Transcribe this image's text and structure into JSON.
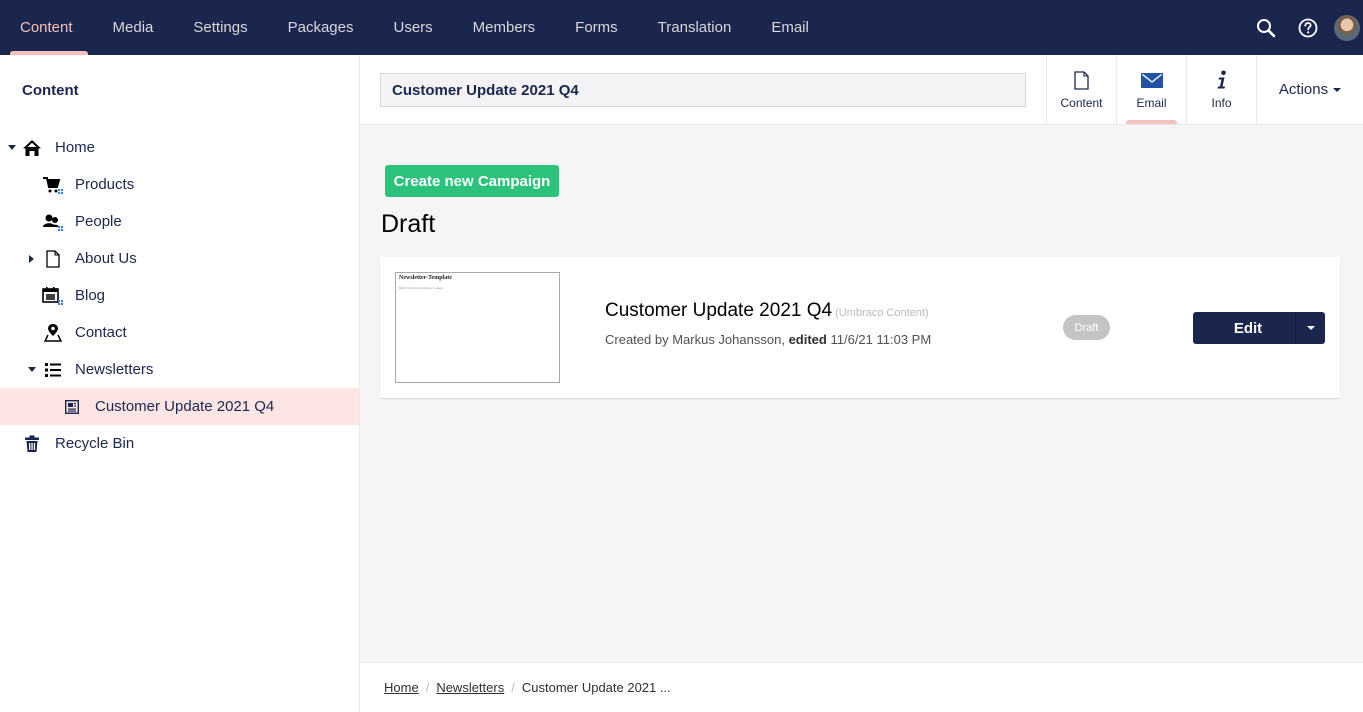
{
  "topnav": {
    "tabs": [
      {
        "label": "Content",
        "active": true
      },
      {
        "label": "Media"
      },
      {
        "label": "Settings"
      },
      {
        "label": "Packages"
      },
      {
        "label": "Users"
      },
      {
        "label": "Members"
      },
      {
        "label": "Forms"
      },
      {
        "label": "Translation"
      },
      {
        "label": "Email"
      }
    ],
    "icons": [
      "search-icon",
      "help-icon",
      "user-avatar"
    ]
  },
  "sidebar": {
    "title": "Content",
    "tree": [
      {
        "label": "Home",
        "icon": "home-icon",
        "expanded": true,
        "level": 0
      },
      {
        "label": "Products",
        "icon": "cart-icon",
        "level": 1
      },
      {
        "label": "People",
        "icon": "people-icon",
        "level": 1
      },
      {
        "label": "About Us",
        "icon": "document-icon",
        "expanded": false,
        "level": 1
      },
      {
        "label": "Blog",
        "icon": "calendar-icon",
        "level": 1
      },
      {
        "label": "Contact",
        "icon": "map-pin-icon",
        "level": 1
      },
      {
        "label": "Newsletters",
        "icon": "list-icon",
        "expanded": true,
        "level": 1
      },
      {
        "label": "Customer Update 2021 Q4",
        "icon": "newspaper-icon",
        "level": 2,
        "selected": true
      },
      {
        "label": "Recycle Bin",
        "icon": "trash-icon",
        "level": 0
      }
    ]
  },
  "editor": {
    "name_value": "Customer Update 2021 Q4",
    "apps": [
      {
        "label": "Content",
        "icon": "document-icon"
      },
      {
        "label": "Email",
        "icon": "envelope-icon",
        "active": true
      },
      {
        "label": "Info",
        "icon": "info-icon"
      }
    ],
    "actions_label": "Actions"
  },
  "main": {
    "create_button": "Create new Campaign",
    "section_title": "Draft",
    "campaign": {
      "thumbnail_title": "Newsletter-Template",
      "thumbnail_text": "Hello World from Umbraco Content",
      "title": "Customer Update 2021 Q4",
      "source": "(Umbraco Content)",
      "created_prefix": "Created by Markus Johansson,",
      "edited_label": "edited",
      "edited_date": "11/6/21 11:03 PM",
      "status": "Draft",
      "edit_label": "Edit"
    }
  },
  "breadcrumb": {
    "items": [
      {
        "label": "Home",
        "link": true
      },
      {
        "label": "Newsletters",
        "link": true
      },
      {
        "label": "Customer Update 2021 ...",
        "link": false
      }
    ]
  },
  "colors": {
    "nav_bg": "#1b264f",
    "accent": "#f5c1bc",
    "selected_bg": "#fde5e4",
    "create_button": "#2bc37c",
    "badge_gray": "#c4c4c4"
  }
}
